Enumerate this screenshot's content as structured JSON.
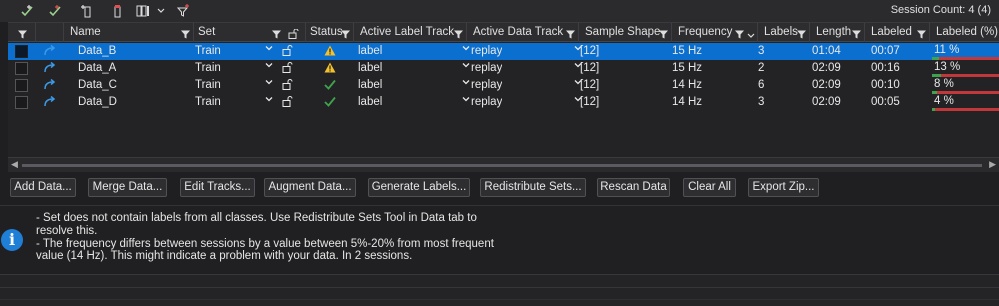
{
  "toolbar": {
    "icons": [
      "add-session-icon",
      "validate-icon",
      "add-track-icon",
      "remove-track-icon",
      "columns-icon",
      "chevron-down-icon",
      "add-filter-icon"
    ],
    "session_count": "Session Count: 4 (4)"
  },
  "columns": {
    "name": "Name",
    "set": "Set",
    "status": "Status",
    "active_label_track": "Active Label Track",
    "active_data_track": "Active Data Track",
    "sample_shape": "Sample Shape",
    "frequency": "Frequency",
    "labels": "Labels",
    "length": "Length",
    "labeled": "Labeled",
    "labeled_pct": "Labeled (%)"
  },
  "rows": [
    {
      "name": "Data_B",
      "set": "Train",
      "status": "warning",
      "label_track": "label",
      "data_track": "replay",
      "shape": "[12]",
      "freq": "15 Hz",
      "labels": "3",
      "length": "01:04",
      "labeled": "00:07",
      "pct": "11 %",
      "pct_value": 0.11,
      "selected": true
    },
    {
      "name": "Data_A",
      "set": "Train",
      "status": "warning",
      "label_track": "label",
      "data_track": "replay",
      "shape": "[12]",
      "freq": "15 Hz",
      "labels": "2",
      "length": "02:09",
      "labeled": "00:16",
      "pct": "13 %",
      "pct_value": 0.13,
      "selected": false
    },
    {
      "name": "Data_C",
      "set": "Train",
      "status": "ok",
      "label_track": "label",
      "data_track": "replay",
      "shape": "[12]",
      "freq": "14 Hz",
      "labels": "6",
      "length": "02:09",
      "labeled": "00:10",
      "pct": "8 %",
      "pct_value": 0.08,
      "selected": false
    },
    {
      "name": "Data_D",
      "set": "Train",
      "status": "ok",
      "label_track": "label",
      "data_track": "replay",
      "shape": "[12]",
      "freq": "14 Hz",
      "labels": "3",
      "length": "02:09",
      "labeled": "00:05",
      "pct": "4 %",
      "pct_value": 0.04,
      "selected": false
    }
  ],
  "buttons": {
    "add_data": "Add Data...",
    "merge_data": "Merge Data...",
    "edit_tracks": "Edit Tracks...",
    "augment_data": "Augment Data...",
    "generate_labels": "Generate Labels...",
    "redistribute_sets": "Redistribute Sets...",
    "rescan_data": "Rescan Data",
    "clear_all": "Clear All",
    "export_zip": "Export Zip..."
  },
  "info": {
    "line1": "- Set does not contain labels from all classes. Use Redistribute Sets Tool in Data tab to resolve this.",
    "line2": "- The frequency differs between sessions by a value between 5%-20% from most frequent value (14 Hz). This might indicate a problem with your data. In 2 sessions."
  },
  "colors": {
    "selection": "#0a6fcf",
    "warning": "#f2c12e",
    "ok": "#3fa34d",
    "unlabeled_bar": "#c2373a",
    "info_icon": "#1f7fd6"
  }
}
